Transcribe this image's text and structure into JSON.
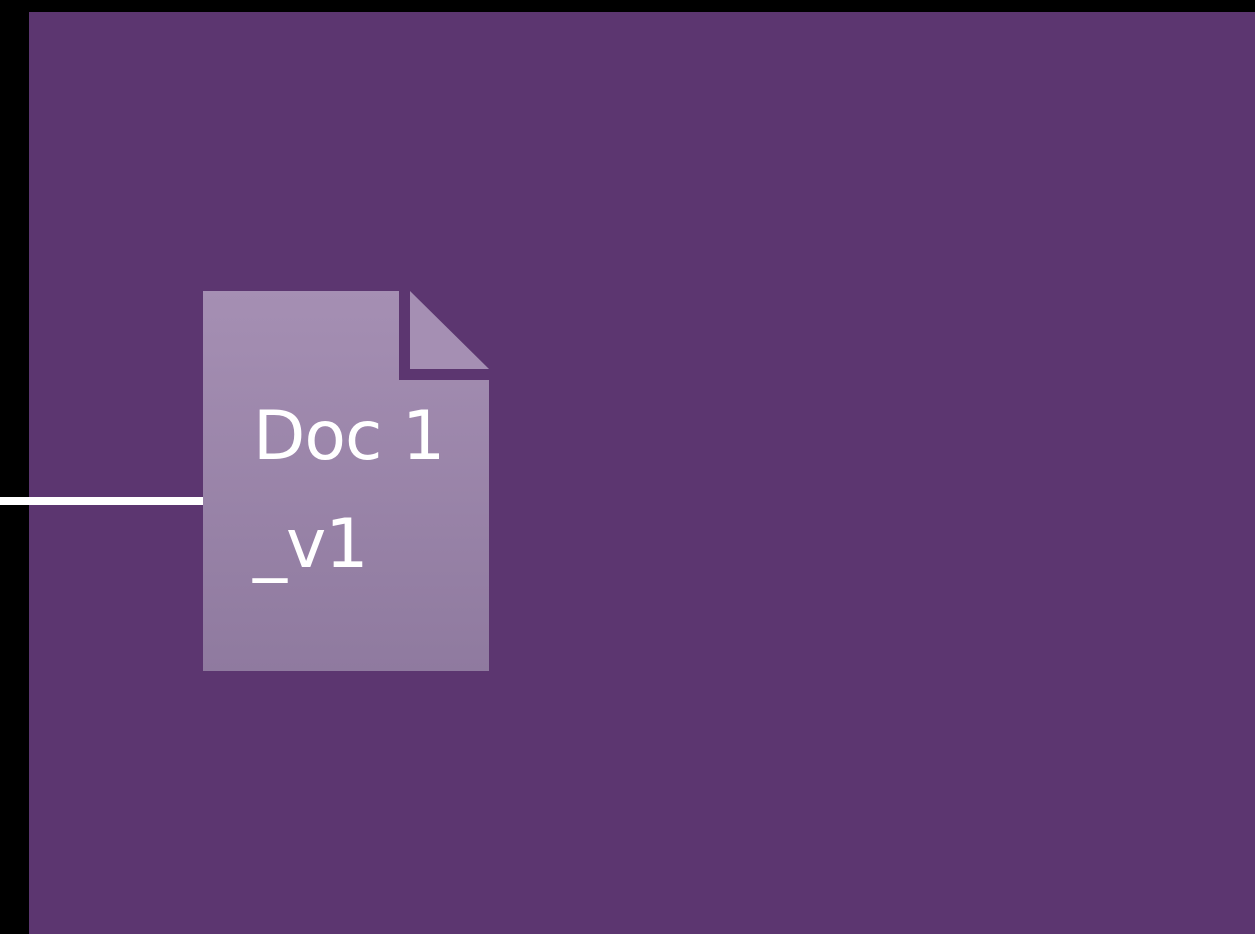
{
  "diagram": {
    "document_node": {
      "icon": "document-icon",
      "label_lines": [
        "Doc 1",
        "_v1"
      ]
    },
    "colors": {
      "background": "#5c3670",
      "outer_border": "#000000",
      "document_fill_top": "#a58fb3",
      "document_fill_bottom": "#8f7a9f",
      "connector": "#ffffff",
      "text": "#ffffff"
    }
  }
}
